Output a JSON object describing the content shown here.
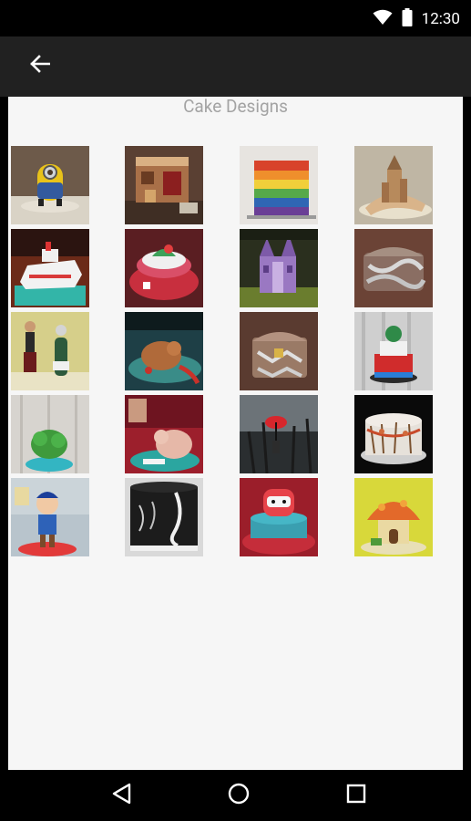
{
  "status_bar": {
    "time": "12:30",
    "icons": [
      "wifi-icon",
      "battery-icon"
    ]
  },
  "toolbar": {
    "back_icon": "arrow-left-icon"
  },
  "page": {
    "title": "Cake Designs"
  },
  "gallery": {
    "rows": 5,
    "columns": 4,
    "items": [
      {
        "subject": "minion cake"
      },
      {
        "subject": "house cake"
      },
      {
        "subject": "rainbow shirt cake"
      },
      {
        "subject": "castle cake"
      },
      {
        "subject": "boat cake"
      },
      {
        "subject": "red cake with figurine"
      },
      {
        "subject": "purple castle cake"
      },
      {
        "subject": "chained chest cake"
      },
      {
        "subject": "figurines with bottle"
      },
      {
        "subject": "creature cake on teal board"
      },
      {
        "subject": "chained treasure chest cake"
      },
      {
        "subject": "hulk tiered cake"
      },
      {
        "subject": "green hulk cake"
      },
      {
        "subject": "elephant cake"
      },
      {
        "subject": "red umbrella painted cake"
      },
      {
        "subject": "painted tree cake"
      },
      {
        "subject": "boy figurine cake"
      },
      {
        "subject": "chalkboard cake"
      },
      {
        "subject": "red character cake"
      },
      {
        "subject": "mushroom house cake"
      }
    ]
  },
  "nav_bar": {
    "icons": [
      "back-triangle-icon",
      "home-circle-icon",
      "recents-square-icon"
    ]
  },
  "colors": {
    "toolbar": "#212121",
    "content_bg": "#f6f6f6",
    "title_text": "#a3a3a3"
  }
}
